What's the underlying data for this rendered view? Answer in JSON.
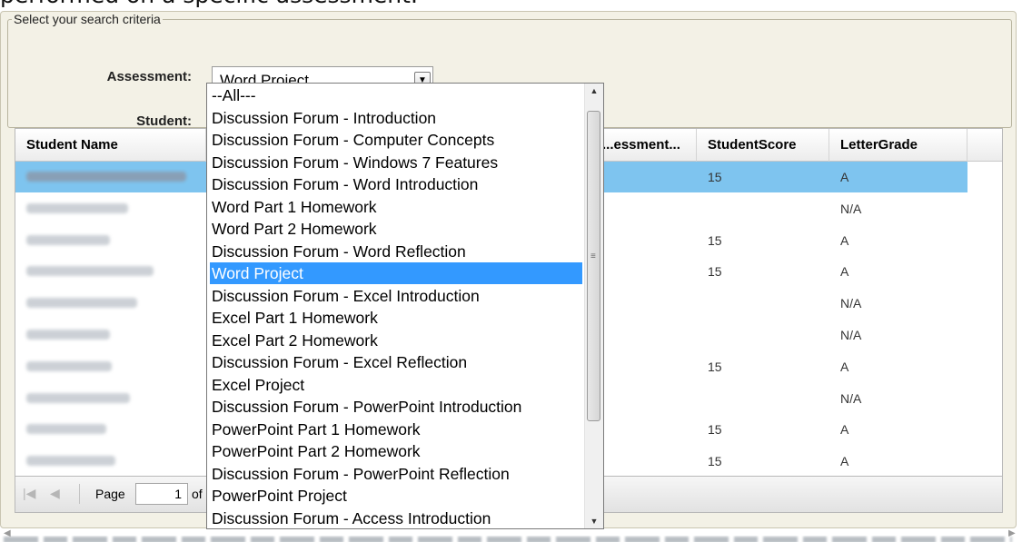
{
  "page": {
    "heading": "performed on a specific assessment."
  },
  "criteria": {
    "legend": "Select your search criteria",
    "assessment_label": "Assessment:",
    "assessment_value": "Word Project",
    "student_label": "Student:"
  },
  "dropdown": {
    "options": [
      "--All---",
      "Discussion Forum - Introduction",
      "Discussion Forum - Computer Concepts",
      "Discussion Forum - Windows 7 Features",
      "Discussion Forum - Word Introduction",
      "Word Part 1 Homework",
      "Word Part 2 Homework",
      "Discussion Forum - Word Reflection",
      "Word Project",
      "Discussion Forum - Excel Introduction",
      "Excel Part 1 Homework",
      "Excel Part 2 Homework",
      "Discussion Forum - Excel Reflection",
      "Excel Project",
      "Discussion Forum - PowerPoint Introduction",
      "PowerPoint Part 1 Homework",
      "PowerPoint Part 2 Homework",
      "Discussion Forum - PowerPoint Reflection",
      "PowerPoint Project",
      "Discussion Forum - Access Introduction"
    ],
    "selected_index": 8
  },
  "grid": {
    "columns": [
      "Student Name",
      "...essment...",
      "StudentScore",
      "LetterGrade"
    ],
    "rows": [
      {
        "name": "Batzer Watson, Mackenzie",
        "score": "15",
        "grade": "A",
        "selected": true
      },
      {
        "name": "Chau, Buu-Hue",
        "score": "",
        "grade": "N/A"
      },
      {
        "name": "Collins, Patti",
        "score": "15",
        "grade": "A"
      },
      {
        "name": "Cowan, Christopher",
        "score": "15",
        "grade": "A"
      },
      {
        "name": "Daniels, Zachariah",
        "score": "",
        "grade": "N/A"
      },
      {
        "name": "Dunn, Brittany",
        "score": "",
        "grade": "N/A"
      },
      {
        "name": "Enns, Nicole",
        "score": "15",
        "grade": "A"
      },
      {
        "name": "Everett, Ronald",
        "score": "",
        "grade": "N/A"
      },
      {
        "name": "Farrow, Keith",
        "score": "15",
        "grade": "A"
      },
      {
        "name": "Garner, Linda",
        "score": "15",
        "grade": "A"
      }
    ]
  },
  "pager": {
    "page_label": "Page",
    "page_value": "1",
    "of_label": "of"
  },
  "icons": {
    "first": "first-page-icon",
    "prev": "prev-page-icon",
    "dropdown": "chevron-down-icon"
  }
}
